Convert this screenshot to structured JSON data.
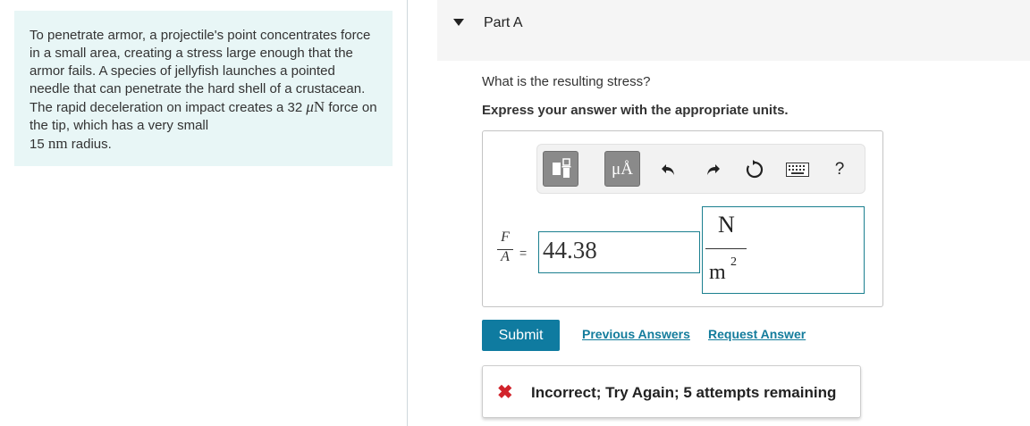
{
  "problem": {
    "text_1": "To penetrate armor, a projectile's point concentrates force in a small area, creating a stress large enough that the armor fails. A species of jellyfish launches a pointed needle that can penetrate the hard shell of a crustacean. The rapid deceleration on impact creates a ",
    "force_value": "32",
    "force_unit_prefix": "μ",
    "force_unit": "N",
    "text_2": " force on the tip, which has a very small",
    "radius_value": "15",
    "radius_unit": "nm",
    "text_3": " radius."
  },
  "part": {
    "title": "Part A"
  },
  "question": "What is the resulting stress?",
  "instruction": "Express your answer with the appropriate units.",
  "toolbar": {
    "units_label": "μÅ",
    "icons": [
      "templates-icon",
      "units-icon",
      "undo-icon",
      "redo-icon",
      "reset-icon",
      "keyboard-icon",
      "help-icon"
    ],
    "help_label": "?"
  },
  "answer": {
    "lhs_numerator": "F",
    "lhs_denominator": "A",
    "equals": "=",
    "value": "44.38",
    "unit_numerator": "N",
    "unit_denominator": "m",
    "unit_exponent": "2"
  },
  "actions": {
    "submit_label": "Submit",
    "previous_answers_label": "Previous Answers",
    "request_answer_label": "Request Answer"
  },
  "feedback": {
    "icon": "✖",
    "text": "Incorrect; Try Again; 5 attempts remaining"
  },
  "colors": {
    "panel_bg": "#e8f6f6",
    "accent": "#0f7ba0",
    "error": "#d1232b"
  }
}
